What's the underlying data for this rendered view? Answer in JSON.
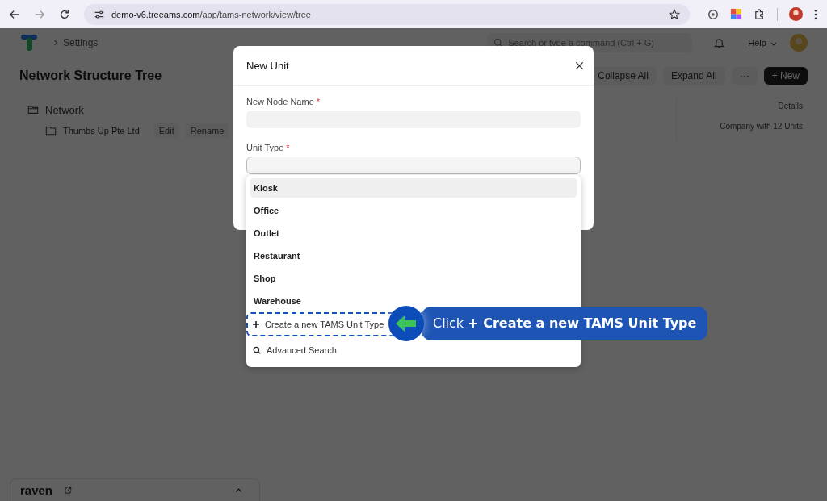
{
  "browser": {
    "url_host": "demo-v6.treeams.com",
    "url_path": "/app/tams-network/view/tree"
  },
  "topbar": {
    "breadcrumb": "Settings",
    "search_placeholder": "Search or type a command (Ctrl + G)",
    "help": "Help"
  },
  "page": {
    "title": "Network Structure Tree",
    "actions": [
      {
        "label": "Collapse All",
        "kind": "plain"
      },
      {
        "label": "Expand All",
        "kind": "plain"
      },
      {
        "label": "···",
        "kind": "plain"
      },
      {
        "label": "+ New",
        "kind": "primary"
      }
    ]
  },
  "tree": {
    "label": "Network",
    "children": [
      {
        "label": "Thumbs Up Pte Ltd",
        "buttons": [
          "Edit",
          "Rename"
        ]
      }
    ]
  },
  "details": {
    "heading": "Details",
    "summary": "Company with  12 Units"
  },
  "chat_panel": {
    "title": "raven",
    "expanded": false
  },
  "dialog": {
    "title": "New Unit",
    "fields": [
      {
        "label": "New Node Name",
        "required_mark": "*"
      },
      {
        "label": "Unit Type",
        "required_mark": "*"
      }
    ]
  },
  "dropdown": {
    "options": [
      {
        "label": "Kiosk",
        "selected": true
      },
      {
        "label": "Office",
        "selected": false
      },
      {
        "label": "Outlet",
        "selected": false
      },
      {
        "label": "Restaurant",
        "selected": false
      },
      {
        "label": "Shop",
        "selected": false
      },
      {
        "label": "Warehouse",
        "selected": false
      }
    ],
    "actions": [
      {
        "kind": "create",
        "label": "Create a new TAMS Unit Type",
        "highlighted": true
      },
      {
        "kind": "search",
        "label": "Advanced Search",
        "highlighted": false
      }
    ]
  },
  "callout": {
    "text": "Click **+ Create a new TAMS Unit Type**"
  }
}
